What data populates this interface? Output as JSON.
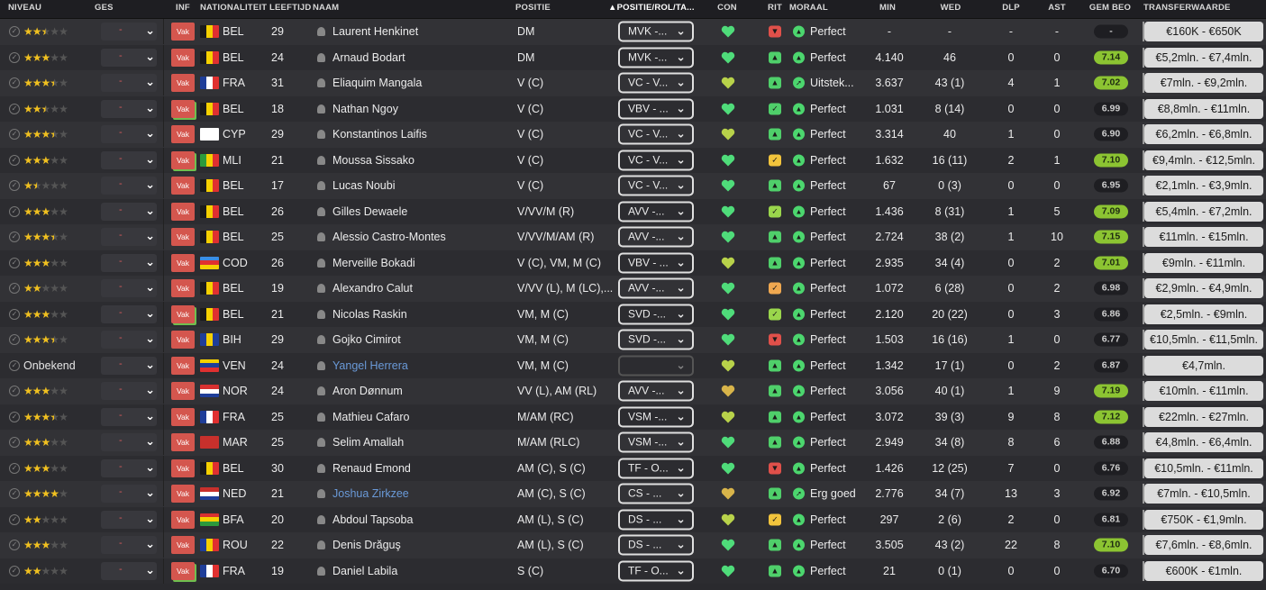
{
  "headers": {
    "niveau": "NIVEAU",
    "ges": "GES",
    "inf": "INF",
    "nationaliteit": "NATIONALITEIT",
    "leeftijd": "LEEFTIJD",
    "naam": "NAAM",
    "positie": "POSITIE",
    "positie_rol": "▲POSITIE/ROL/TA...",
    "con": "CON",
    "rit": "RIT",
    "moraal": "MORAAL",
    "min": "MIN",
    "wed": "WED",
    "dlp": "DLP",
    "ast": "AST",
    "gem_beo": "GEM BEO",
    "transferwaarde": "TRANSFERWAARDE"
  },
  "colors": {
    "heart_green": "#4fdc7a",
    "heart_yellow": "#b8d24a",
    "heart_gold": "#d8b44a",
    "rit_green": "#4fcf6a",
    "rit_light": "#9ad64c",
    "rit_orange": "#f0a850",
    "rit_yellow": "#f2c43c",
    "rit_red": "#e0504a",
    "rating_good": "#8cc432"
  },
  "players": [
    {
      "stars": 2.5,
      "level_text": "",
      "inf": "Vak",
      "inf_pending": false,
      "flag": [
        "#1a1a1a",
        "#f5d000",
        "#e03030"
      ],
      "flag_dir": "row",
      "nat": "BEL",
      "age": "29",
      "name": "Laurent Henkinet",
      "name_link": false,
      "pos": "DM",
      "role": "MVK -...",
      "heart": "green",
      "rit": "red",
      "rit_icon": "thumbs-down-icon",
      "mor_icon": "arrow-up-icon",
      "moraal": "Perfect",
      "min": "-",
      "wed": "-",
      "dlp": "-",
      "ast": "-",
      "rating": "-",
      "rating_good": false,
      "tv": "€160K - €650K"
    },
    {
      "stars": 3,
      "level_text": "",
      "inf": "Vak",
      "inf_pending": false,
      "flag": [
        "#1a1a1a",
        "#f5d000",
        "#e03030"
      ],
      "flag_dir": "row",
      "nat": "BEL",
      "age": "24",
      "name": "Arnaud Bodart",
      "name_link": false,
      "pos": "DM",
      "role": "MVK -...",
      "heart": "green",
      "rit": "green",
      "rit_icon": "thumbs-up-icon",
      "mor_icon": "arrow-up-icon",
      "moraal": "Perfect",
      "min": "4.140",
      "wed": "46",
      "dlp": "0",
      "ast": "0",
      "rating": "7.14",
      "rating_good": true,
      "tv": "€5,2mln. - €7,4mln."
    },
    {
      "stars": 3.5,
      "level_text": "",
      "inf": "Vak",
      "inf_pending": false,
      "flag": [
        "#1f3e99",
        "#ffffff",
        "#e03030"
      ],
      "flag_dir": "row",
      "nat": "FRA",
      "age": "31",
      "name": "Eliaquim Mangala",
      "name_link": false,
      "pos": "V (C)",
      "role": "VC - V...",
      "heart": "yellow",
      "rit": "green",
      "rit_icon": "thumbs-up-icon",
      "mor_icon": "arrow-up-right-icon",
      "moraal": "Uitstek...",
      "min": "3.637",
      "wed": "43 (1)",
      "dlp": "4",
      "ast": "1",
      "rating": "7.02",
      "rating_good": true,
      "tv": "€7mln. - €9,2mln."
    },
    {
      "stars": 2.5,
      "level_text": "",
      "inf": "Vak",
      "inf_pending": true,
      "flag": [
        "#1a1a1a",
        "#f5d000",
        "#e03030"
      ],
      "flag_dir": "row",
      "nat": "BEL",
      "age": "18",
      "name": "Nathan Ngoy",
      "name_link": false,
      "pos": "V (C)",
      "role": "VBV - ...",
      "heart": "green",
      "rit": "green",
      "rit_icon": "check-icon",
      "mor_icon": "arrow-up-icon",
      "moraal": "Perfect",
      "min": "1.031",
      "wed": "8 (14)",
      "dlp": "0",
      "ast": "0",
      "rating": "6.99",
      "rating_good": false,
      "tv": "€8,8mln. - €11mln."
    },
    {
      "stars": 3.5,
      "level_text": "",
      "inf": "Vak",
      "inf_pending": false,
      "flag": [
        "#ffffff",
        "#ffffff",
        "#ffffff"
      ],
      "flag_dir": "row",
      "nat": "CYP",
      "age": "29",
      "name": "Konstantinos Laifis",
      "name_link": false,
      "pos": "V (C)",
      "role": "VC - V...",
      "heart": "yellow",
      "rit": "green",
      "rit_icon": "thumbs-up-icon",
      "mor_icon": "arrow-up-icon",
      "moraal": "Perfect",
      "min": "3.314",
      "wed": "40",
      "dlp": "1",
      "ast": "0",
      "rating": "6.90",
      "rating_good": false,
      "tv": "€6,2mln. - €6,8mln."
    },
    {
      "stars": 3,
      "level_text": "",
      "inf": "Vak",
      "inf_pending": true,
      "flag": [
        "#2c9a3c",
        "#f5d000",
        "#e03030"
      ],
      "flag_dir": "row",
      "nat": "MLI",
      "age": "21",
      "name": "Moussa Sissako",
      "name_link": false,
      "pos": "V (C)",
      "role": "VC - V...",
      "heart": "green",
      "rit": "yellow",
      "rit_icon": "check-icon",
      "mor_icon": "arrow-up-icon",
      "moraal": "Perfect",
      "min": "1.632",
      "wed": "16 (11)",
      "dlp": "2",
      "ast": "1",
      "rating": "7.10",
      "rating_good": true,
      "tv": "€9,4mln. - €12,5mln."
    },
    {
      "stars": 1.5,
      "level_text": "",
      "inf": "Vak",
      "inf_pending": false,
      "flag": [
        "#1a1a1a",
        "#f5d000",
        "#e03030"
      ],
      "flag_dir": "row",
      "nat": "BEL",
      "age": "17",
      "name": "Lucas Noubi",
      "name_link": false,
      "pos": "V (C)",
      "role": "VC - V...",
      "heart": "green",
      "rit": "green",
      "rit_icon": "thumbs-up-icon",
      "mor_icon": "arrow-up-icon",
      "moraal": "Perfect",
      "min": "67",
      "wed": "0 (3)",
      "dlp": "0",
      "ast": "0",
      "rating": "6.95",
      "rating_good": false,
      "tv": "€2,1mln. - €3,9mln."
    },
    {
      "stars": 3,
      "level_text": "",
      "inf": "Vak",
      "inf_pending": false,
      "flag": [
        "#1a1a1a",
        "#f5d000",
        "#e03030"
      ],
      "flag_dir": "row",
      "nat": "BEL",
      "age": "26",
      "name": "Gilles Dewaele",
      "name_link": false,
      "pos": "V/VV/M (R)",
      "role": "AVV -...",
      "heart": "green",
      "rit": "light",
      "rit_icon": "check-icon",
      "mor_icon": "arrow-up-icon",
      "moraal": "Perfect",
      "min": "1.436",
      "wed": "8 (31)",
      "dlp": "1",
      "ast": "5",
      "rating": "7.09",
      "rating_good": true,
      "tv": "€5,4mln. - €7,2mln."
    },
    {
      "stars": 3.5,
      "level_text": "",
      "inf": "Vak",
      "inf_pending": false,
      "flag": [
        "#1a1a1a",
        "#f5d000",
        "#e03030"
      ],
      "flag_dir": "row",
      "nat": "BEL",
      "age": "25",
      "name": "Alessio Castro-Montes",
      "name_link": false,
      "pos": "V/VV/M/AM (R)",
      "role": "AVV -...",
      "heart": "green",
      "rit": "green",
      "rit_icon": "thumbs-up-icon",
      "mor_icon": "arrow-up-icon",
      "moraal": "Perfect",
      "min": "2.724",
      "wed": "38 (2)",
      "dlp": "1",
      "ast": "10",
      "rating": "7.15",
      "rating_good": true,
      "tv": "€11mln. - €15mln."
    },
    {
      "stars": 3,
      "level_text": "",
      "inf": "Vak",
      "inf_pending": false,
      "flag": [
        "#3a8ee6",
        "#e03030",
        "#f5d000"
      ],
      "flag_dir": "column",
      "nat": "COD",
      "age": "26",
      "name": "Merveille Bokadi",
      "name_link": false,
      "pos": "V (C), VM, M (C)",
      "role": "VBV - ...",
      "heart": "yellow",
      "rit": "green",
      "rit_icon": "thumbs-up-icon",
      "mor_icon": "arrow-up-icon",
      "moraal": "Perfect",
      "min": "2.935",
      "wed": "34 (4)",
      "dlp": "0",
      "ast": "2",
      "rating": "7.01",
      "rating_good": true,
      "tv": "€9mln. - €11mln."
    },
    {
      "stars": 2,
      "level_text": "",
      "inf": "Vak",
      "inf_pending": false,
      "flag": [
        "#1a1a1a",
        "#f5d000",
        "#e03030"
      ],
      "flag_dir": "row",
      "nat": "BEL",
      "age": "19",
      "name": "Alexandro Calut",
      "name_link": false,
      "pos": "V/VV (L), M (LC),...",
      "role": "AVV -...",
      "heart": "green",
      "rit": "orange",
      "rit_icon": "check-icon",
      "mor_icon": "arrow-up-icon",
      "moraal": "Perfect",
      "min": "1.072",
      "wed": "6 (28)",
      "dlp": "0",
      "ast": "2",
      "rating": "6.98",
      "rating_good": false,
      "tv": "€2,9mln. - €4,9mln."
    },
    {
      "stars": 3,
      "level_text": "",
      "inf": "Vak",
      "inf_pending": true,
      "flag": [
        "#1a1a1a",
        "#f5d000",
        "#e03030"
      ],
      "flag_dir": "row",
      "nat": "BEL",
      "age": "21",
      "name": "Nicolas Raskin",
      "name_link": false,
      "pos": "VM, M (C)",
      "role": "SVD -...",
      "heart": "green",
      "rit": "light",
      "rit_icon": "check-icon",
      "mor_icon": "arrow-up-icon",
      "moraal": "Perfect",
      "min": "2.120",
      "wed": "20 (22)",
      "dlp": "0",
      "ast": "3",
      "rating": "6.86",
      "rating_good": false,
      "tv": "€2,5mln. - €9mln."
    },
    {
      "stars": 3.5,
      "level_text": "",
      "inf": "Vak",
      "inf_pending": false,
      "flag": [
        "#1f3e99",
        "#f5d000",
        "#1f3e99"
      ],
      "flag_dir": "row",
      "nat": "BIH",
      "age": "29",
      "name": "Gojko Cimirot",
      "name_link": false,
      "pos": "VM, M (C)",
      "role": "SVD -...",
      "heart": "green",
      "rit": "red",
      "rit_icon": "thumbs-down-icon",
      "mor_icon": "arrow-up-icon",
      "moraal": "Perfect",
      "min": "1.503",
      "wed": "16 (16)",
      "dlp": "1",
      "ast": "0",
      "rating": "6.77",
      "rating_good": false,
      "tv": "€10,5mln. - €11,5mln."
    },
    {
      "stars": 0,
      "level_text": "Onbekend",
      "inf": "Vak",
      "inf_pending": false,
      "flag": [
        "#f5d000",
        "#1f3e99",
        "#e03030"
      ],
      "flag_dir": "column",
      "nat": "VEN",
      "age": "24",
      "name": "Yangel Herrera",
      "name_link": true,
      "pos": "VM, M (C)",
      "role": "",
      "heart": "yellow",
      "rit": "green",
      "rit_icon": "thumbs-up-icon",
      "mor_icon": "arrow-up-icon",
      "moraal": "Perfect",
      "min": "1.342",
      "wed": "17 (1)",
      "dlp": "0",
      "ast": "2",
      "rating": "6.87",
      "rating_good": false,
      "tv": "€4,7mln."
    },
    {
      "stars": 3,
      "level_text": "",
      "inf": "Vak",
      "inf_pending": false,
      "flag": [
        "#d83030",
        "#ffffff",
        "#1f3e99"
      ],
      "flag_dir": "column",
      "nat": "NOR",
      "age": "24",
      "name": "Aron Dønnum",
      "name_link": false,
      "pos": "VV (L), AM (RL)",
      "role": "AVV -...",
      "heart": "gold",
      "rit": "green",
      "rit_icon": "thumbs-up-icon",
      "mor_icon": "arrow-up-icon",
      "moraal": "Perfect",
      "min": "3.056",
      "wed": "40 (1)",
      "dlp": "1",
      "ast": "9",
      "rating": "7.19",
      "rating_good": true,
      "tv": "€10mln. - €11mln."
    },
    {
      "stars": 3.5,
      "level_text": "",
      "inf": "Vak",
      "inf_pending": false,
      "flag": [
        "#1f3e99",
        "#ffffff",
        "#e03030"
      ],
      "flag_dir": "row",
      "nat": "FRA",
      "age": "25",
      "name": "Mathieu Cafaro",
      "name_link": false,
      "pos": "M/AM (RC)",
      "role": "VSM -...",
      "heart": "yellow",
      "rit": "green",
      "rit_icon": "thumbs-up-icon",
      "mor_icon": "arrow-up-icon",
      "moraal": "Perfect",
      "min": "3.072",
      "wed": "39 (3)",
      "dlp": "9",
      "ast": "8",
      "rating": "7.12",
      "rating_good": true,
      "tv": "€22mln. - €27mln."
    },
    {
      "stars": 3,
      "level_text": "",
      "inf": "Vak",
      "inf_pending": false,
      "flag": [
        "#c8302c",
        "#c8302c",
        "#c8302c"
      ],
      "flag_dir": "row",
      "nat": "MAR",
      "age": "25",
      "name": "Selim Amallah",
      "name_link": false,
      "pos": "M/AM (RLC)",
      "role": "VSM -...",
      "heart": "green",
      "rit": "green",
      "rit_icon": "thumbs-up-icon",
      "mor_icon": "arrow-up-icon",
      "moraal": "Perfect",
      "min": "2.949",
      "wed": "34 (8)",
      "dlp": "8",
      "ast": "6",
      "rating": "6.88",
      "rating_good": false,
      "tv": "€4,8mln. - €6,4mln."
    },
    {
      "stars": 3,
      "level_text": "",
      "inf": "Vak",
      "inf_pending": false,
      "flag": [
        "#1a1a1a",
        "#f5d000",
        "#e03030"
      ],
      "flag_dir": "row",
      "nat": "BEL",
      "age": "30",
      "name": "Renaud Emond",
      "name_link": false,
      "pos": "AM (C), S (C)",
      "role": "TF - O...",
      "heart": "green",
      "rit": "red",
      "rit_icon": "thumbs-down-icon",
      "mor_icon": "arrow-up-icon",
      "moraal": "Perfect",
      "min": "1.426",
      "wed": "12 (25)",
      "dlp": "7",
      "ast": "0",
      "rating": "6.76",
      "rating_good": false,
      "tv": "€10,5mln. - €11mln."
    },
    {
      "stars": 4,
      "level_text": "",
      "inf": "Vak",
      "inf_pending": false,
      "flag": [
        "#c8302c",
        "#ffffff",
        "#1f3e99"
      ],
      "flag_dir": "column",
      "nat": "NED",
      "age": "21",
      "name": "Joshua Zirkzee",
      "name_link": true,
      "pos": "AM (C), S (C)",
      "role": "CS - ...",
      "heart": "gold",
      "rit": "green",
      "rit_icon": "thumbs-up-icon",
      "mor_icon": "arrow-up-right-icon",
      "moraal": "Erg goed",
      "min": "2.776",
      "wed": "34 (7)",
      "dlp": "13",
      "ast": "3",
      "rating": "6.92",
      "rating_good": false,
      "tv": "€7mln. - €10,5mln."
    },
    {
      "stars": 2,
      "level_text": "",
      "inf": "Vak",
      "inf_pending": false,
      "flag": [
        "#d83030",
        "#f5d000",
        "#2c9a3c"
      ],
      "flag_dir": "column",
      "nat": "BFA",
      "age": "20",
      "name": "Abdoul Tapsoba",
      "name_link": false,
      "pos": "AM (L), S (C)",
      "role": "DS - ...",
      "heart": "yellow",
      "rit": "yellow",
      "rit_icon": "check-icon",
      "mor_icon": "arrow-up-icon",
      "moraal": "Perfect",
      "min": "297",
      "wed": "2 (6)",
      "dlp": "2",
      "ast": "0",
      "rating": "6.81",
      "rating_good": false,
      "tv": "€750K - €1,9mln."
    },
    {
      "stars": 3,
      "level_text": "",
      "inf": "Vak",
      "inf_pending": false,
      "flag": [
        "#1f3e99",
        "#f5d000",
        "#e03030"
      ],
      "flag_dir": "row",
      "nat": "ROU",
      "age": "22",
      "name": "Denis Drăguş",
      "name_link": false,
      "pos": "AM (L), S (C)",
      "role": "DS - ...",
      "heart": "green",
      "rit": "green",
      "rit_icon": "thumbs-up-icon",
      "mor_icon": "arrow-up-icon",
      "moraal": "Perfect",
      "min": "3.505",
      "wed": "43 (2)",
      "dlp": "22",
      "ast": "8",
      "rating": "7.10",
      "rating_good": true,
      "tv": "€7,6mln. - €8,6mln."
    },
    {
      "stars": 2,
      "level_text": "",
      "inf": "Vak",
      "inf_pending": true,
      "flag": [
        "#1f3e99",
        "#ffffff",
        "#e03030"
      ],
      "flag_dir": "row",
      "nat": "FRA",
      "age": "19",
      "name": "Daniel Labila",
      "name_link": false,
      "pos": "S (C)",
      "role": "TF - O...",
      "heart": "green",
      "rit": "green",
      "rit_icon": "thumbs-up-icon",
      "mor_icon": "arrow-up-icon",
      "moraal": "Perfect",
      "min": "21",
      "wed": "0 (1)",
      "dlp": "0",
      "ast": "0",
      "rating": "6.70",
      "rating_good": false,
      "tv": "€600K - €1mln."
    }
  ]
}
